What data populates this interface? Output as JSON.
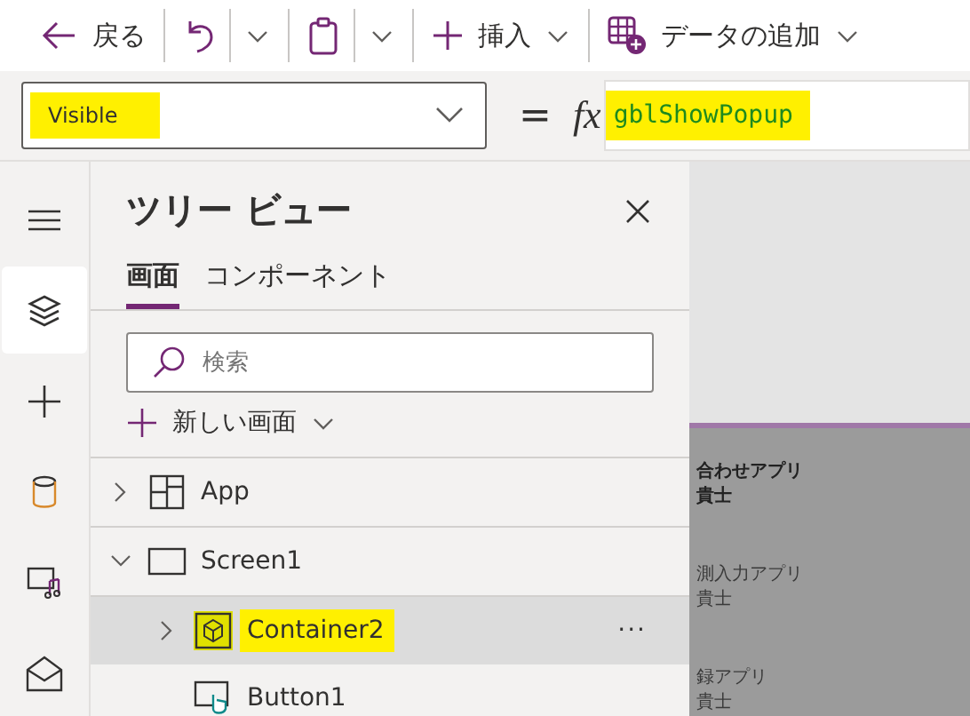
{
  "toolbar": [
    {
      "kind": "back",
      "label": "戻る"
    },
    {
      "kind": "undo"
    },
    {
      "kind": "paste"
    },
    {
      "kind": "insert",
      "label": "挿入"
    },
    {
      "kind": "data",
      "label": "データの追加"
    }
  ],
  "formula_bar": {
    "property": "Visible",
    "property_highlighted": true,
    "equals": "=",
    "fx": "fx",
    "formula": "gblShowPopup",
    "formula_highlighted": true
  },
  "rail": [
    {
      "kind": "menu",
      "selected": false
    },
    {
      "kind": "layers",
      "selected": true
    },
    {
      "kind": "plus",
      "selected": false
    },
    {
      "kind": "data",
      "selected": false
    },
    {
      "kind": "media",
      "selected": false
    },
    {
      "kind": "more",
      "selected": false
    }
  ],
  "tree_view": {
    "title": "ツリー ビュー",
    "tabs": [
      {
        "label": "画面",
        "selected": true
      },
      {
        "label": "コンポーネント",
        "selected": false
      }
    ],
    "search": {
      "placeholder": "検索"
    },
    "new_screen": "新しい画面",
    "items": [
      {
        "kind": "app",
        "label": "App",
        "expanded": false,
        "selected": false,
        "highlighted": false
      },
      {
        "kind": "screen",
        "label": "Screen1",
        "expanded": true,
        "selected": false,
        "highlighted": false,
        "children": [
          {
            "kind": "container",
            "label": "Container2",
            "expanded": false,
            "selected": true,
            "highlighted": true,
            "more": "···"
          },
          {
            "kind": "button",
            "label": "Button1",
            "selected": false,
            "highlighted": false
          }
        ]
      }
    ]
  },
  "canvas": {
    "items": [
      {
        "title": "合わせアプリ",
        "subtitle": "貴士",
        "bold": true
      },
      {
        "title": "測入力アプリ",
        "subtitle": "貴士",
        "bold": false
      },
      {
        "title": "録アプリ",
        "subtitle": "貴士",
        "bold": false
      }
    ]
  }
}
